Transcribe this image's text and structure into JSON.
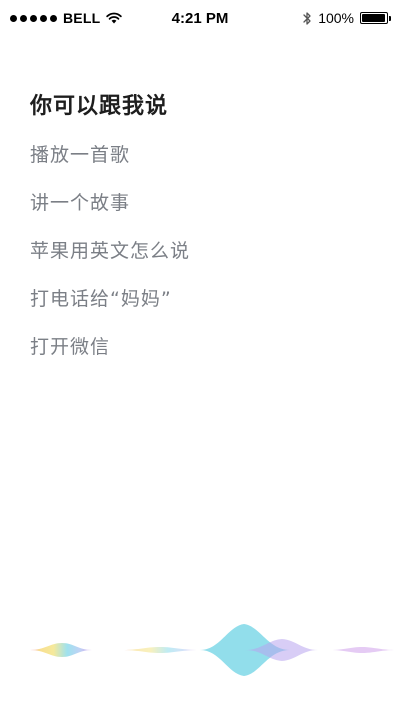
{
  "status_bar": {
    "carrier": "BELL",
    "time": "4:21 PM",
    "battery_percent_label": "100%",
    "battery_level": 1.0,
    "signal_bars": 5,
    "icons": [
      "signal-dots-icon",
      "wifi-icon",
      "bluetooth-icon",
      "battery-icon"
    ]
  },
  "assistant": {
    "heading": "你可以跟我说",
    "suggestions": [
      {
        "label": "播放一首歌"
      },
      {
        "label": "讲一个故事"
      },
      {
        "label": "苹果用英文怎么说"
      },
      {
        "label": "打电话给“妈妈”"
      },
      {
        "label": "打开微信"
      }
    ]
  },
  "waveform": {
    "icon": "voice-waveform-icon",
    "colors": [
      "#f06d8a",
      "#f6d36b",
      "#f2e27a",
      "#7fd8e8",
      "#a9c4f2",
      "#c58be6"
    ]
  }
}
